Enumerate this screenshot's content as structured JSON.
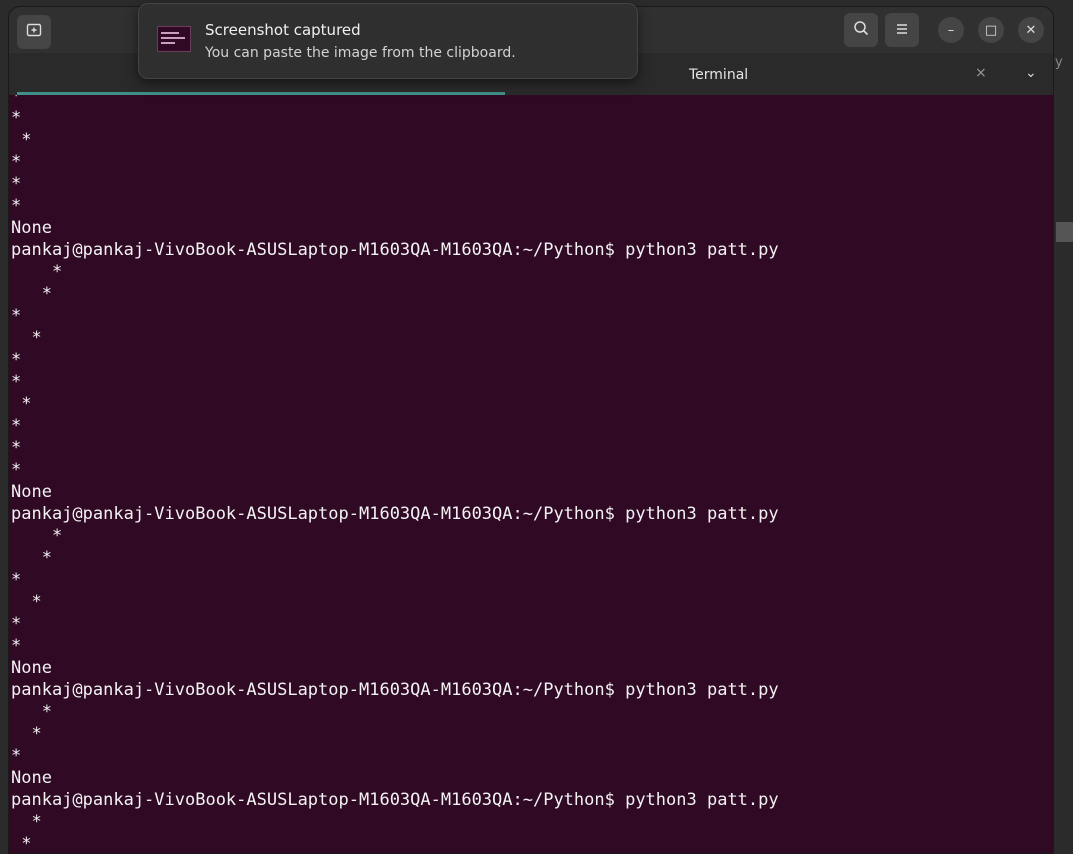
{
  "notification": {
    "title": "Screenshot captured",
    "message": "You can paste the image from the clipboard."
  },
  "window": {
    "tab_title": "Terminal",
    "buttons": {
      "new_tab_icon": "new-tab-icon",
      "search_icon": "search-icon",
      "menu_icon": "hamburger-menu-icon",
      "minimize": "–",
      "maximize": "□",
      "close": "✕"
    },
    "tab_close": "×",
    "tab_menu": "⌄"
  },
  "background_edge_text": "y",
  "terminal": {
    "lines": [
      "*",
      "*",
      " *",
      "*",
      "*",
      "*",
      "None",
      "pankaj@pankaj-VivoBook-ASUSLaptop-M1603QA-M1603QA:~/Python$ python3 patt.py",
      "    *",
      "   *",
      "*",
      "  *",
      "*",
      "*",
      " *",
      "*",
      "*",
      "*",
      "None",
      "pankaj@pankaj-VivoBook-ASUSLaptop-M1603QA-M1603QA:~/Python$ python3 patt.py",
      "    *",
      "   *",
      "*",
      "  *",
      "*",
      "*",
      "None",
      "pankaj@pankaj-VivoBook-ASUSLaptop-M1603QA-M1603QA:~/Python$ python3 patt.py",
      "   *",
      "  *",
      "*",
      "None",
      "pankaj@pankaj-VivoBook-ASUSLaptop-M1603QA-M1603QA:~/Python$ python3 patt.py",
      "  *",
      " *"
    ]
  },
  "colors": {
    "terminal_bg": "#300a24",
    "accent": "#3f8f88",
    "text": "#f2f2f2"
  }
}
